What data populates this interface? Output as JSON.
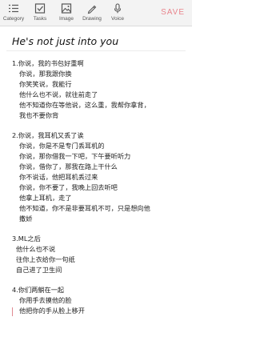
{
  "toolbar": {
    "category": "Category",
    "tasks": "Tasks",
    "image": "Image",
    "drawing": "Drawing",
    "voice": "Voice",
    "save": "SAVE"
  },
  "note": {
    "title": "He's not just into you",
    "lines": [
      "1.你说，我的书包好重啊",
      "你说，那我跟你换",
      "你笑笑说，我能行",
      "他什么也不说，就往前走了",
      "他不知道你在等他说，这么重，我帮你拿背，",
      "我也不要你背",
      "2.你说，我耳机又丢了诶",
      "你说，你是不是专门丢耳机的",
      "你说，那你借我一下吧，下午要听听力",
      "你说，借你了，那我在路上干什么",
      "你不说话，他把耳机丢过来",
      "你说，你不要了，我晚上回去听吧",
      "他拿上耳机，走了",
      "他不知道，你不是非要耳机不可，只是想向他",
      "撒娇",
      "3.ML之后",
      "他什么也不说",
      "往你上衣给你一句纸",
      "自己进了卫生间",
      "4.你们两躺在一起",
      "你用手去摸他的脸",
      "他把你的手从脸上移开"
    ]
  },
  "colors": {
    "accent": "#e9858d",
    "toolbar_bg": "#f3f3f3"
  }
}
